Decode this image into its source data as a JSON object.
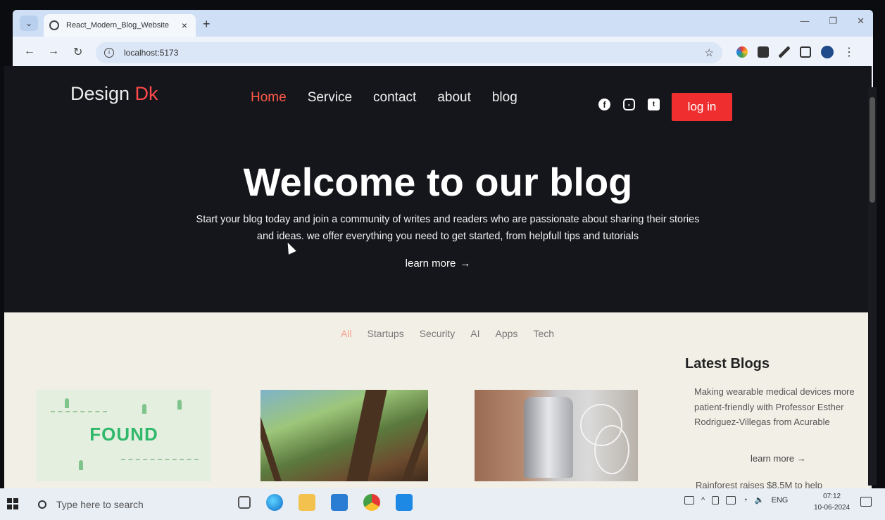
{
  "browser": {
    "tab_title": "React_Modern_Blog_Website",
    "url": "localhost:5173",
    "new_tab_label": "+",
    "close_label": "×"
  },
  "site": {
    "logo_main": "Design ",
    "logo_accent": "Dk",
    "nav": [
      "Home",
      "Service",
      "contact",
      "about",
      "blog"
    ],
    "login_label": "log in"
  },
  "hero": {
    "title": "Welcome to our blog",
    "subtitle": "Start your blog today and join a community of writes and readers who are passionate about sharing their stories and ideas. we offer everything you need to get started, from helpfull tips and tutorials",
    "learn_more": "learn more"
  },
  "filters": [
    "All",
    "Startups",
    "Security",
    "AI",
    "Apps",
    "Tech"
  ],
  "cards": {
    "card1_text": "FOUND"
  },
  "latest": {
    "title": "Latest Blogs",
    "item1": "Making wearable medical devices more patient-friendly with Professor Esther Rodriguez-Villegas from Acurable",
    "learn_more": "learn more",
    "item2": "Rainforest raises $8.5M to help"
  },
  "taskbar": {
    "search_placeholder": "Type here to search",
    "lang": "ENG",
    "time": "07:12",
    "date": "10-06-2024"
  },
  "colors": {
    "accent_red": "#ef2f2f",
    "nav_active": "#ff5a48",
    "hero_bg": "#15161b",
    "content_bg": "#f1efe6"
  }
}
